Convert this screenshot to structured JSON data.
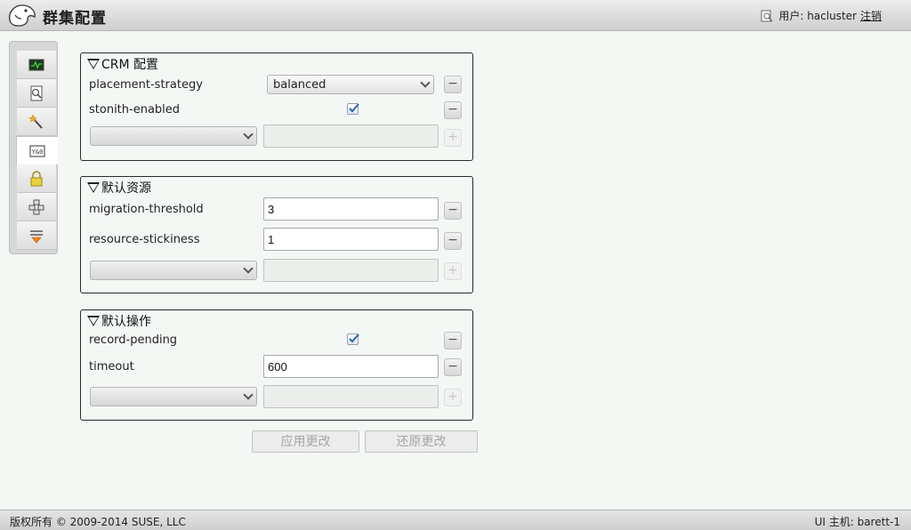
{
  "header": {
    "title": "群集配置",
    "user_label": "用户: hacluster",
    "logout": "注销"
  },
  "sidebar": {
    "items": [
      {
        "name": "status-icon"
      },
      {
        "name": "history-icon"
      },
      {
        "name": "wizard-icon"
      },
      {
        "name": "config-icon",
        "active": true
      },
      {
        "name": "acl-icon"
      },
      {
        "name": "cluster-icon"
      },
      {
        "name": "dashboard-icon"
      }
    ]
  },
  "crm": {
    "title": "CRM 配置",
    "placement_label": "placement-strategy",
    "placement_value": "balanced",
    "stonith_label": "stonith-enabled",
    "stonith_checked": true,
    "remove": "−",
    "add": "+"
  },
  "resource_defaults": {
    "title": "默认资源",
    "migration_label": "migration-threshold",
    "migration_value": "3",
    "stickiness_label": "resource-stickiness",
    "stickiness_value": "1"
  },
  "op_defaults": {
    "title": "默认操作",
    "record_label": "record-pending",
    "record_checked": true,
    "timeout_label": "timeout",
    "timeout_value": "600"
  },
  "actions": {
    "apply": "应用更改",
    "revert": "还原更改"
  },
  "footer": {
    "copyright": "版权所有 © 2009-2014 SUSE, LLC",
    "host": "UI 主机: barett-1"
  },
  "colors": {
    "background": "#f4f8f4",
    "header": "#d8d8d8",
    "panel_border": "#2a2a2a"
  }
}
